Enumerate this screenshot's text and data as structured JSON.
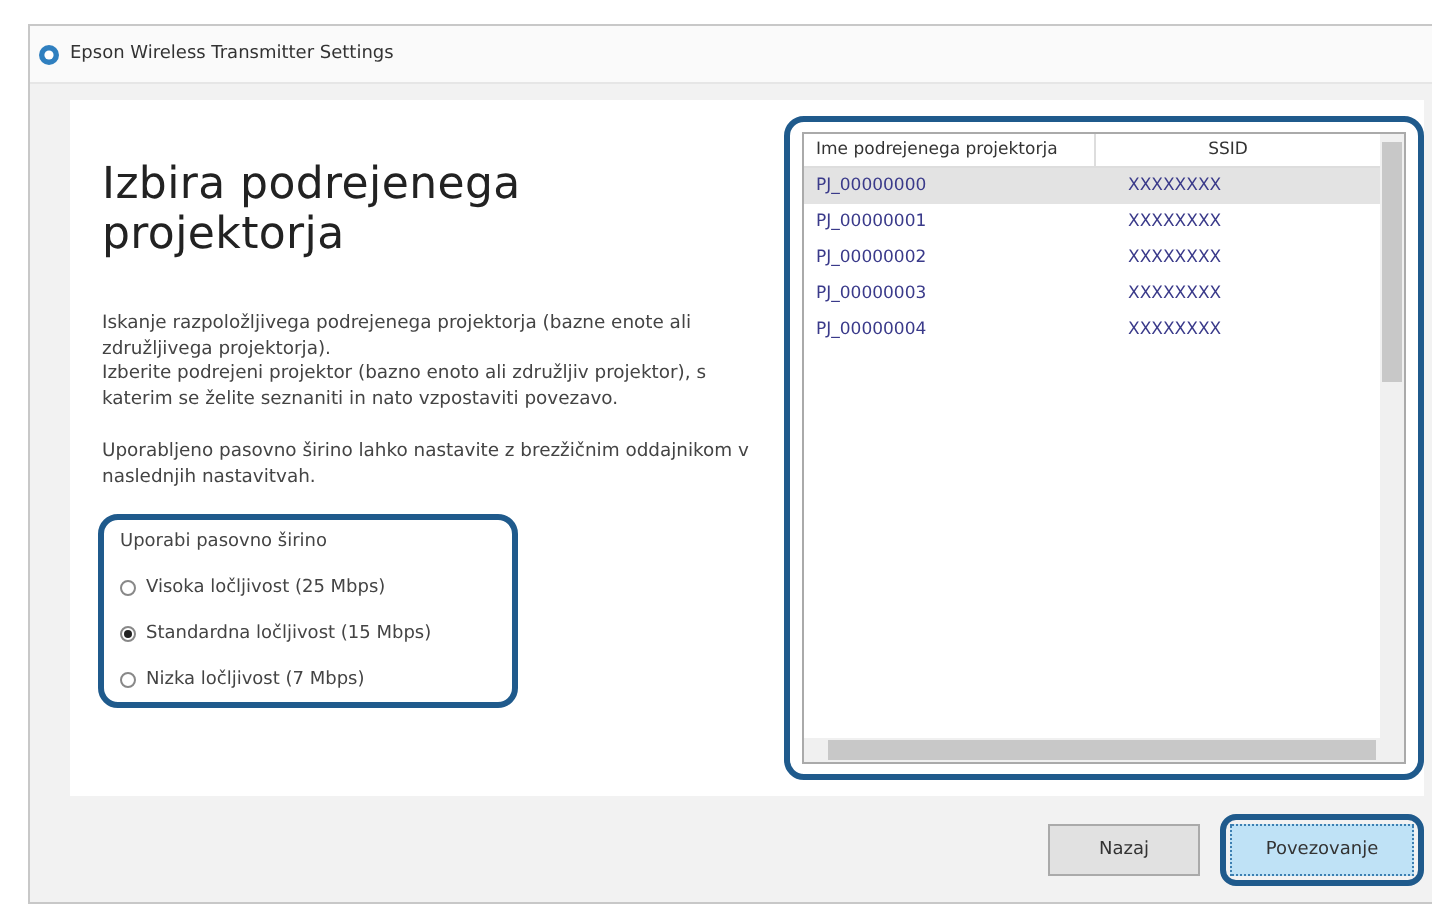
{
  "window": {
    "title": "Epson Wireless Transmitter Settings"
  },
  "heading": "Izbira podrejenega projektorja",
  "paragraphs": [
    "Iskanje razpoložljivega podrejenega projektorja (bazne enote ali združljivega projektorja).\nIzberite podrejeni projektor (bazno enoto ali združljiv projektor), s katerim se želite seznaniti in nato vzpostaviti povezavo.",
    "Uporabljeno pasovno širino lahko nastavite z brezžičnim oddajnikom v naslednjih nastavitvah."
  ],
  "bandwidth": {
    "label": "Uporabi pasovno širino",
    "options": [
      {
        "label": "Visoka ločljivost (25 Mbps)",
        "selected": false
      },
      {
        "label": "Standardna ločljivost (15 Mbps)",
        "selected": true
      },
      {
        "label": "Nizka ločljivost (7 Mbps)",
        "selected": false
      }
    ]
  },
  "table": {
    "columns": [
      "Ime podrejenega projektorja",
      "SSID"
    ],
    "rows": [
      {
        "cells": [
          "PJ_00000000",
          "XXXXXXXX"
        ],
        "selected": true
      },
      {
        "cells": [
          "PJ_00000001",
          "XXXXXXXX"
        ],
        "selected": false
      },
      {
        "cells": [
          "PJ_00000002",
          "XXXXXXXX"
        ],
        "selected": false
      },
      {
        "cells": [
          "PJ_00000003",
          "XXXXXXXX"
        ],
        "selected": false
      },
      {
        "cells": [
          "PJ_00000004",
          "XXXXXXXX"
        ],
        "selected": false
      }
    ]
  },
  "buttons": [
    {
      "label": "Nazaj",
      "kind": "normal"
    },
    {
      "label": "Povezovanje",
      "kind": "default"
    }
  ]
}
